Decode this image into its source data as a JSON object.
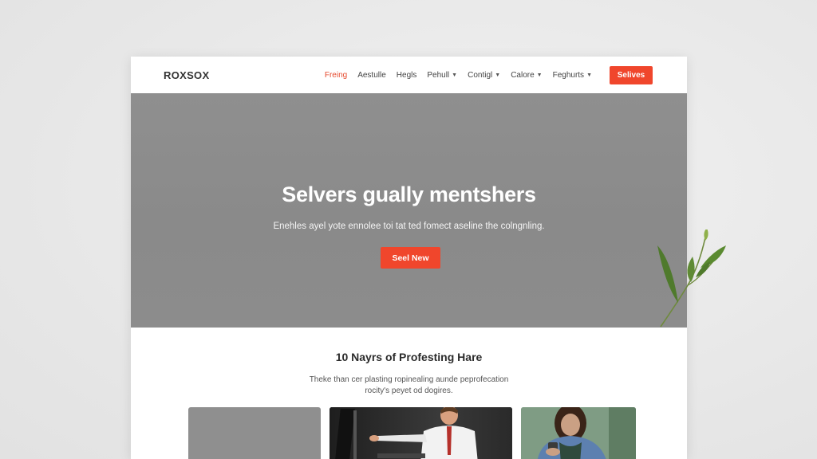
{
  "nav": {
    "logo": "ROXSOX",
    "items": [
      {
        "label": "Freing",
        "active": true,
        "dropdown": false
      },
      {
        "label": "Aestulle",
        "active": false,
        "dropdown": false
      },
      {
        "label": "Hegls",
        "active": false,
        "dropdown": false
      },
      {
        "label": "Pehull",
        "active": false,
        "dropdown": true
      },
      {
        "label": "Contigl",
        "active": false,
        "dropdown": true
      },
      {
        "label": "Calore",
        "active": false,
        "dropdown": true
      },
      {
        "label": "Feghurts",
        "active": false,
        "dropdown": true
      }
    ],
    "cta_label": "Selives"
  },
  "hero": {
    "title": "Selvers gually mentshers",
    "subtitle": "Enehles ayel yote ennolee toi tat ted fomect aseline the colngnling.",
    "cta_label": "Seel New"
  },
  "section": {
    "title": "10 Nayrs of Profesting Hare",
    "description_line1": "Theke than cer plasting ropinealing aunde peprofecation",
    "description_line2": "rocity's peyet od dogires."
  },
  "colors": {
    "accent": "#f0462c",
    "hero_bg": "#8c8c8c",
    "page_bg": "#e9e9e9"
  },
  "icons": {
    "dropdown": "chevron-down-icon",
    "decoration": "plant-sprig-icon"
  }
}
